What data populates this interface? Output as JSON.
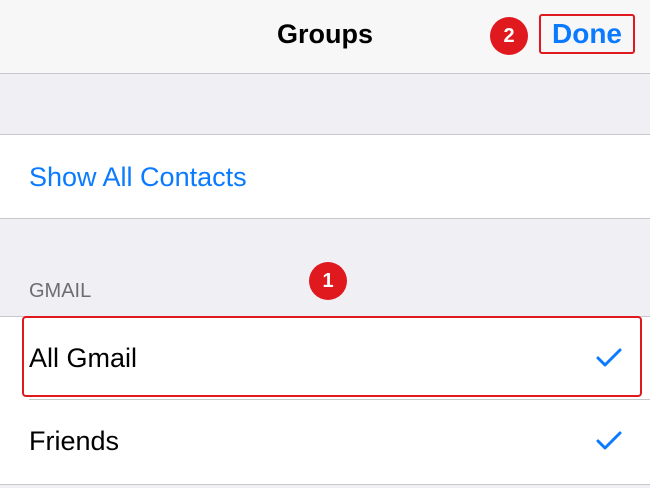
{
  "navbar": {
    "title": "Groups",
    "done_label": "Done"
  },
  "annotations": {
    "step_1": "1",
    "step_2": "2",
    "highlight_color": "#e0191f"
  },
  "show_all": {
    "label": "Show All Contacts"
  },
  "section": {
    "header": "GMAIL",
    "items": [
      {
        "label": "All Gmail",
        "checked": true,
        "icon": "checkmark-icon"
      },
      {
        "label": "Friends",
        "checked": true,
        "icon": "checkmark-icon"
      }
    ]
  },
  "colors": {
    "accent": "#0a7aff",
    "annotation": "#e0191f"
  }
}
